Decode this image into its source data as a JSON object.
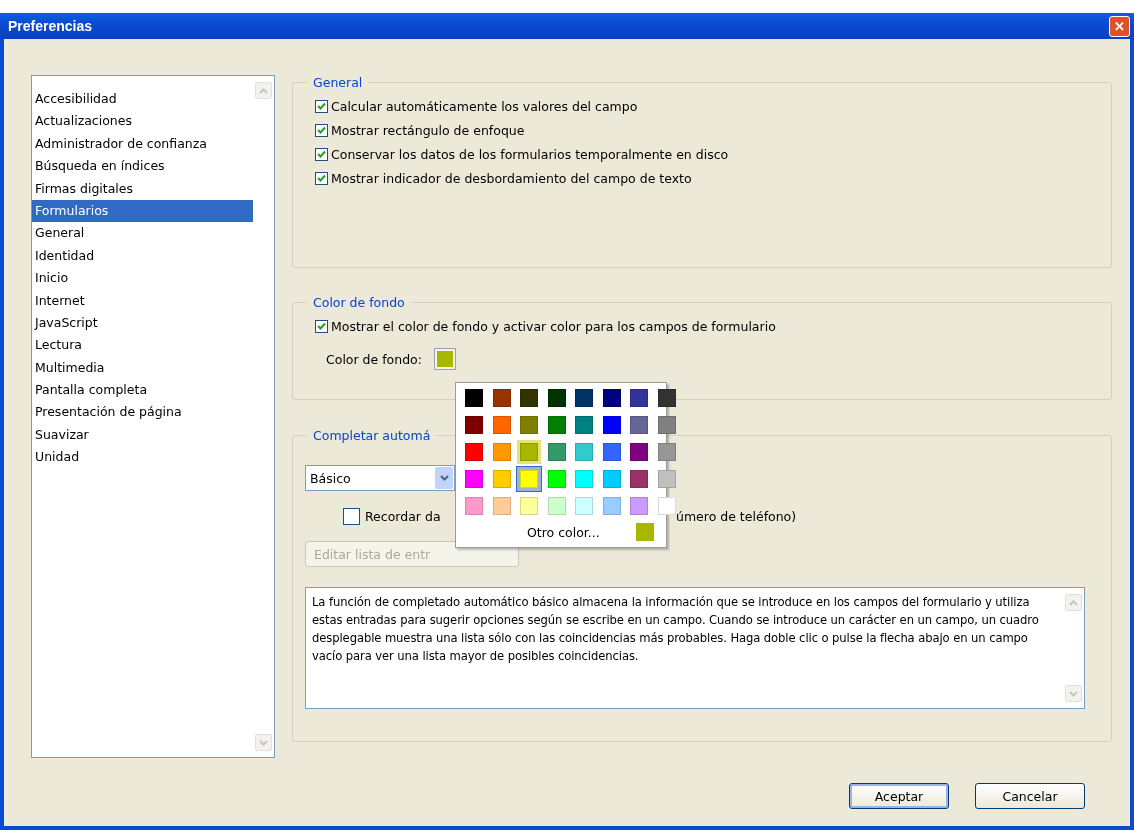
{
  "window": {
    "title": "Preferencias",
    "close": "✕"
  },
  "categories": [
    {
      "label": "Accesibilidad",
      "selected": false
    },
    {
      "label": "Actualizaciones",
      "selected": false
    },
    {
      "label": "Administrador de confianza",
      "selected": false
    },
    {
      "label": "Búsqueda en índices",
      "selected": false
    },
    {
      "label": "Firmas digitales",
      "selected": false
    },
    {
      "label": "Formularios",
      "selected": true
    },
    {
      "label": "General",
      "selected": false
    },
    {
      "label": "Identidad",
      "selected": false
    },
    {
      "label": "Inicio",
      "selected": false
    },
    {
      "label": "Internet",
      "selected": false
    },
    {
      "label": "JavaScript",
      "selected": false
    },
    {
      "label": "Lectura",
      "selected": false
    },
    {
      "label": "Multimedia",
      "selected": false
    },
    {
      "label": "Pantalla completa",
      "selected": false
    },
    {
      "label": "Presentación de página",
      "selected": false
    },
    {
      "label": "Suavizar",
      "selected": false
    },
    {
      "label": "Unidad",
      "selected": false
    }
  ],
  "general": {
    "title": "General",
    "options": [
      {
        "label": "Calcular automáticamente los valores del campo",
        "checked": true
      },
      {
        "label": "Mostrar rectángulo de enfoque",
        "checked": true
      },
      {
        "label": "Conservar los datos de los formularios temporalmente en disco",
        "checked": true
      },
      {
        "label": "Mostrar indicador de desbordamiento del campo de texto",
        "checked": true
      }
    ]
  },
  "background": {
    "title": "Color de fondo",
    "option": {
      "label": "Mostrar el color de fondo y activar color para los campos de formulario",
      "checked": true
    },
    "color_label": "Color de fondo:",
    "color": "#a8b800"
  },
  "autocomplete": {
    "title": "Completar automá",
    "mode": "Básico",
    "remember": {
      "label_start": "Recordar da",
      "label_end": "úmero de teléfono)",
      "checked": false
    },
    "edit_button": "Editar lista de entr",
    "description": "La función de completado automático básico almacena la información que se introduce en los campos del formulario y utiliza estas entradas para sugerir opciones según se escribe en un campo. Cuando se introduce un carácter en un campo, un cuadro desplegable muestra una lista sólo con las coincidencias más probables. Haga doble clic o pulse la flecha abajo en un campo vacío para ver una lista mayor de posibles coincidencias."
  },
  "color_popup": {
    "swatches": [
      {
        "color": "#000000",
        "selected": false,
        "hovered": false
      },
      {
        "color": "#993300",
        "selected": false,
        "hovered": false
      },
      {
        "color": "#333300",
        "selected": false,
        "hovered": false
      },
      {
        "color": "#003300",
        "selected": false,
        "hovered": false
      },
      {
        "color": "#003366",
        "selected": false,
        "hovered": false
      },
      {
        "color": "#000080",
        "selected": false,
        "hovered": false
      },
      {
        "color": "#333399",
        "selected": false,
        "hovered": false
      },
      {
        "color": "#333333",
        "selected": false,
        "hovered": false
      },
      {
        "color": "#800000",
        "selected": false,
        "hovered": false
      },
      {
        "color": "#ff6600",
        "selected": false,
        "hovered": false
      },
      {
        "color": "#808000",
        "selected": false,
        "hovered": false
      },
      {
        "color": "#008000",
        "selected": false,
        "hovered": false
      },
      {
        "color": "#008080",
        "selected": false,
        "hovered": false
      },
      {
        "color": "#0000ff",
        "selected": false,
        "hovered": false
      },
      {
        "color": "#666699",
        "selected": false,
        "hovered": false
      },
      {
        "color": "#808080",
        "selected": false,
        "hovered": false
      },
      {
        "color": "#ff0000",
        "selected": false,
        "hovered": false
      },
      {
        "color": "#ff9900",
        "selected": false,
        "hovered": false
      },
      {
        "color": "#a8b800",
        "selected": false,
        "hovered": true
      },
      {
        "color": "#339966",
        "selected": false,
        "hovered": false
      },
      {
        "color": "#33cccc",
        "selected": false,
        "hovered": false
      },
      {
        "color": "#3366ff",
        "selected": false,
        "hovered": false
      },
      {
        "color": "#800080",
        "selected": false,
        "hovered": false
      },
      {
        "color": "#969696",
        "selected": false,
        "hovered": false
      },
      {
        "color": "#ff00ff",
        "selected": false,
        "hovered": false
      },
      {
        "color": "#ffcc00",
        "selected": false,
        "hovered": false
      },
      {
        "color": "#ffff00",
        "selected": true,
        "hovered": false
      },
      {
        "color": "#00ff00",
        "selected": false,
        "hovered": false
      },
      {
        "color": "#00ffff",
        "selected": false,
        "hovered": false
      },
      {
        "color": "#00ccff",
        "selected": false,
        "hovered": false
      },
      {
        "color": "#993366",
        "selected": false,
        "hovered": false
      },
      {
        "color": "#c0c0c0",
        "selected": false,
        "hovered": false
      },
      {
        "color": "#ff99cc",
        "selected": false,
        "hovered": false
      },
      {
        "color": "#ffcc99",
        "selected": false,
        "hovered": false
      },
      {
        "color": "#ffff99",
        "selected": false,
        "hovered": false
      },
      {
        "color": "#ccffcc",
        "selected": false,
        "hovered": false
      },
      {
        "color": "#ccffff",
        "selected": false,
        "hovered": false
      },
      {
        "color": "#99ccff",
        "selected": false,
        "hovered": false
      },
      {
        "color": "#cc99ff",
        "selected": false,
        "hovered": false
      },
      {
        "color": "#ffffff",
        "selected": false,
        "hovered": false
      }
    ],
    "other": {
      "label": "Otro color...",
      "color": "#a8b800"
    }
  },
  "buttons": [
    {
      "label": "Aceptar",
      "kind": "default"
    },
    {
      "label": "Cancelar",
      "kind": "normal"
    }
  ]
}
